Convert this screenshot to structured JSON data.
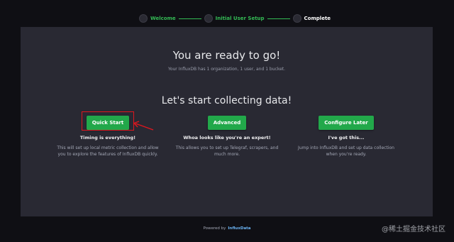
{
  "stepper": {
    "steps": [
      {
        "label": "Welcome",
        "state": "done"
      },
      {
        "label": "Initial User Setup",
        "state": "done"
      },
      {
        "label": "Complete",
        "state": "current"
      }
    ]
  },
  "main": {
    "title": "You are ready to go!",
    "subtitle": "Your InfluxDB has 1 organization, 1 user, and 1 bucket.",
    "section_heading": "Let's start collecting data!",
    "options": [
      {
        "button": "Quick Start",
        "heading": "Timing is everything!",
        "desc_line1": "This will set up local metric collection and allow",
        "desc_line2": "you to explore the features of InfluxDB quickly."
      },
      {
        "button": "Advanced",
        "heading": "Whoa looks like you're an expert!",
        "desc_line1": "This allows you to set up Telegraf, scrapers, and",
        "desc_line2": "much more."
      },
      {
        "button": "Configure Later",
        "heading": "I've got this...",
        "desc_line1": "Jump into InfluxDB and set up data collection",
        "desc_line2": "when you're ready."
      }
    ]
  },
  "footer": {
    "powered_by": "Powered by",
    "brand": "InfluxData"
  },
  "watermark": "@稀土掘金技术社区",
  "colors": {
    "accent_green": "#22a84a",
    "step_done": "#34bb55",
    "annotation_red": "#e0161e"
  }
}
